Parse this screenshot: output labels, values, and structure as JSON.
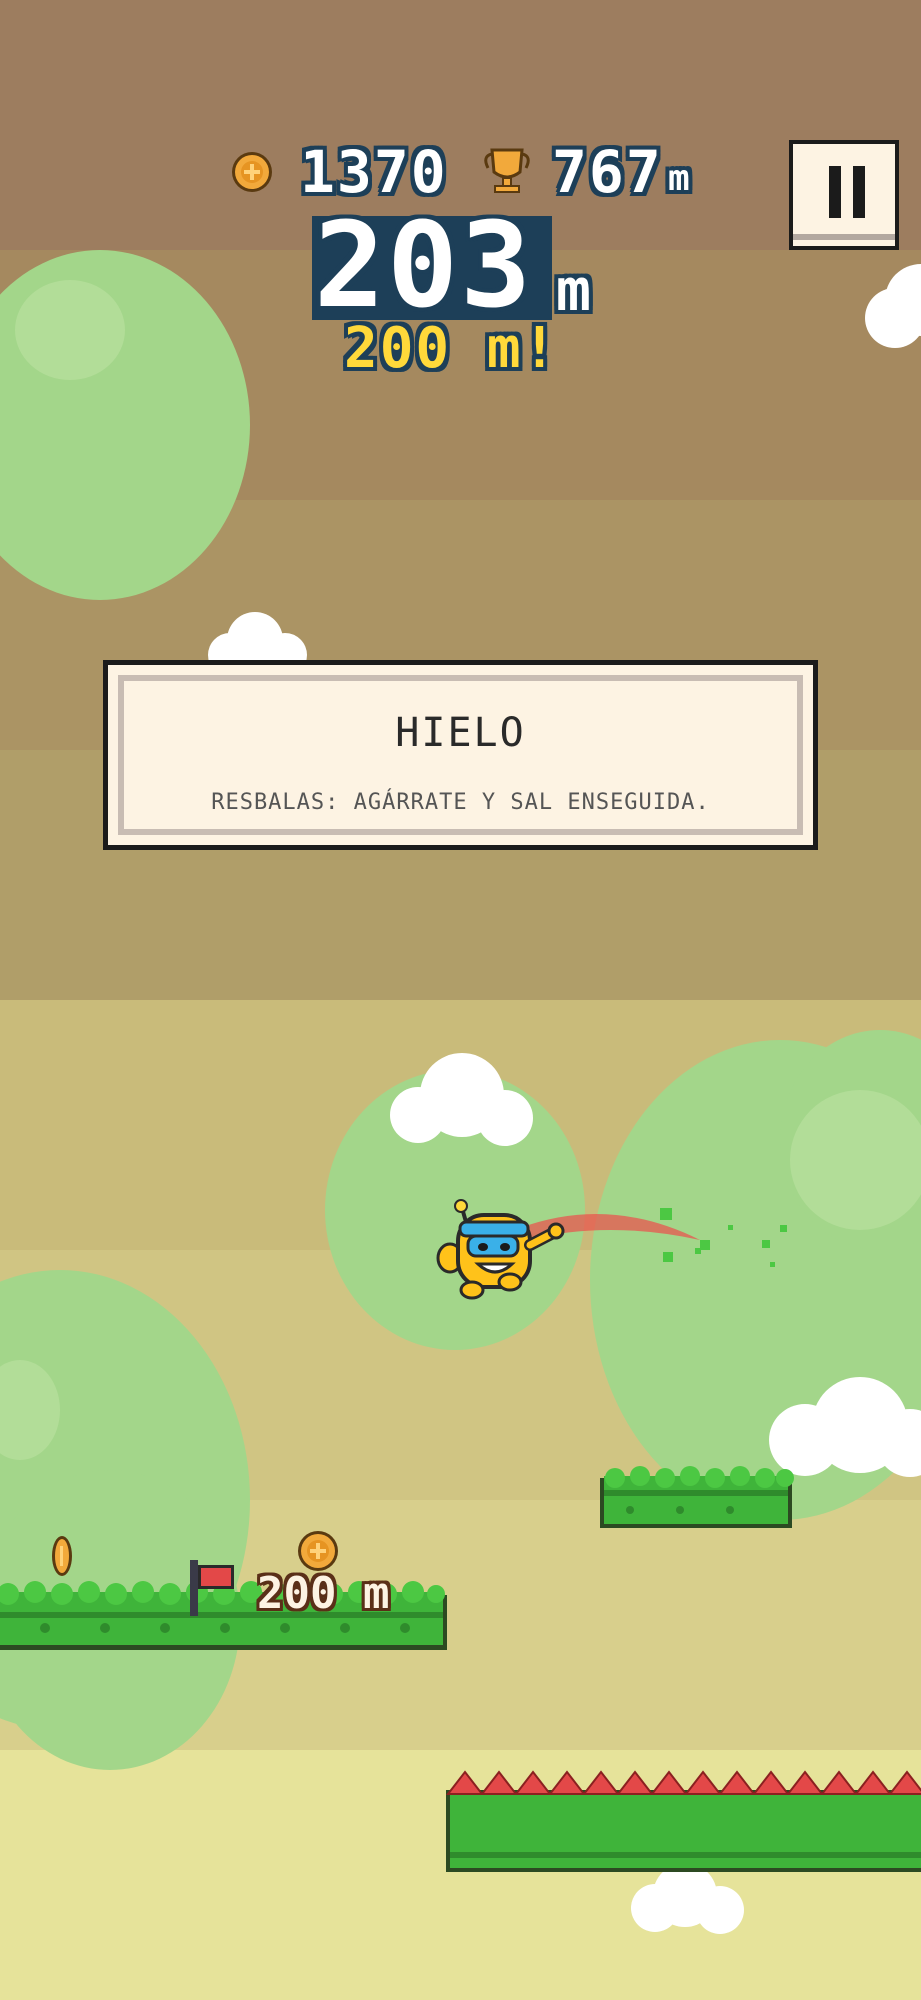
{
  "hud": {
    "coins": "1370",
    "best": "767",
    "best_unit": "m",
    "distance": "203",
    "distance_unit": "m",
    "milestone_alert": "200 m!",
    "pause_icon": "pause-icon",
    "coin_icon": "coin-icon",
    "trophy_icon": "trophy-icon"
  },
  "tip": {
    "title": "HIELO",
    "text": "RESBALAS: AGÁRRATE Y SAL ENSEGUIDA."
  },
  "world": {
    "marker_label": "200 m",
    "player": "yellow-robot-character",
    "colors": {
      "sky_top": "#9d7d5f",
      "sky_band2": "#a5895f",
      "grass": "#3fb43a",
      "spikes": "#e34848",
      "hud_outline": "#1d3f58",
      "alert_yellow": "#ffd93a"
    }
  }
}
